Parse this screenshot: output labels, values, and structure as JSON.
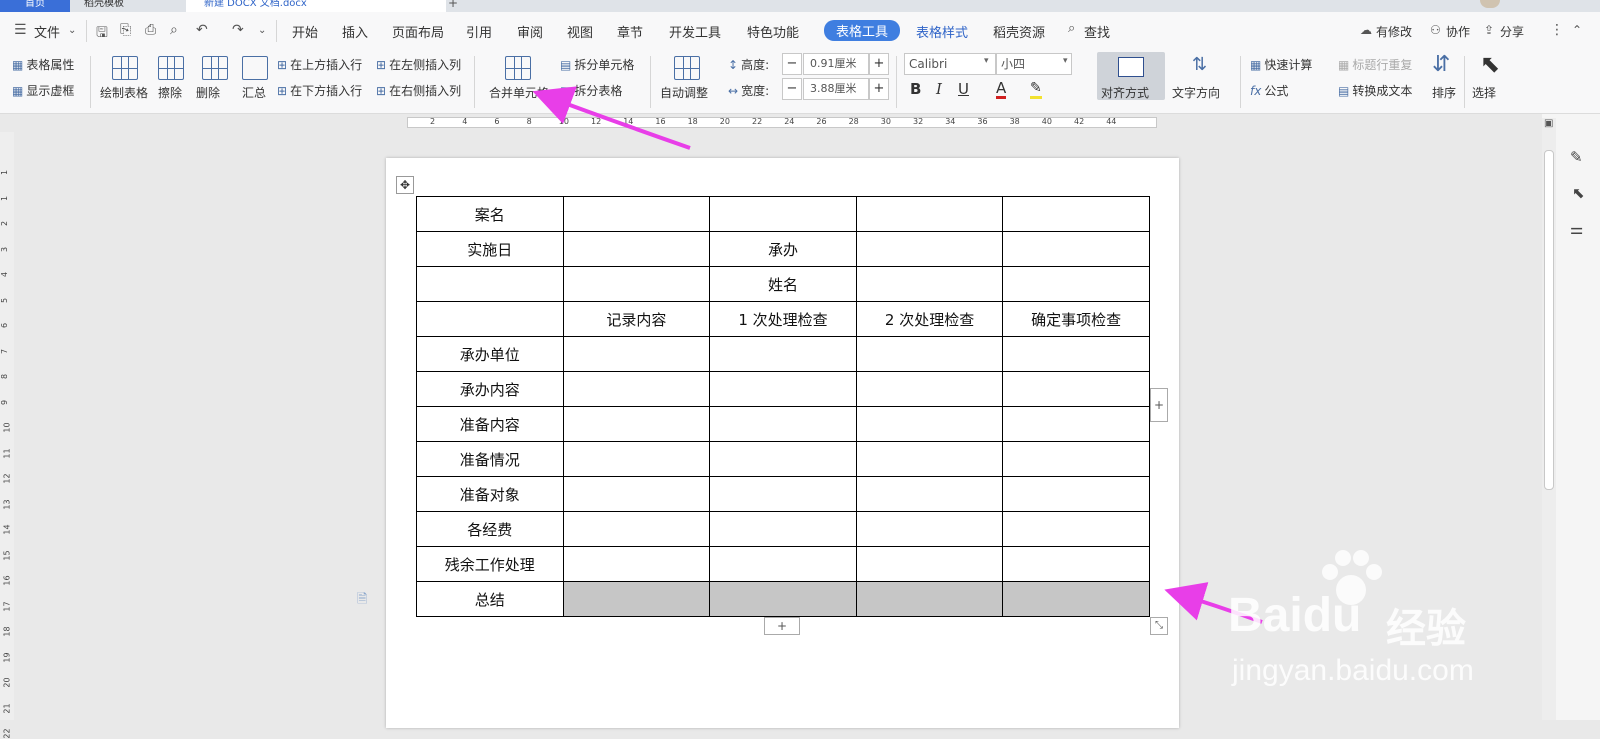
{
  "tabs": {
    "home": "首页",
    "template": "稻壳模板",
    "document": "新建 DOCX 文档.docx",
    "add": "+"
  },
  "menu": {
    "file": "文件",
    "items": [
      "开始",
      "插入",
      "页面布局",
      "引用",
      "审阅",
      "视图",
      "章节",
      "开发工具",
      "特色功能"
    ],
    "table_tools": "表格工具",
    "table_style": "表格样式",
    "docer": "稻壳资源",
    "search": "查找",
    "modify": "有修改",
    "collab": "协作",
    "share": "分享"
  },
  "ribbon": {
    "table_props": "表格属性",
    "show_gridlines": "显示虚框",
    "draw_table": "绘制表格",
    "erase": "擦除",
    "delete": "删除",
    "summary": "汇总",
    "insert_row_above": "在上方插入行",
    "insert_row_below": "在下方插入行",
    "insert_col_left": "在左侧插入列",
    "insert_col_right": "在右侧插入列",
    "merge_cells": "合并单元格",
    "split_cells": "拆分单元格",
    "split_table": "拆分表格",
    "auto_fit": "自动调整",
    "height_label": "高度:",
    "height_value": "0.91厘米",
    "width_label": "宽度:",
    "width_value": "3.88厘米",
    "font_name": "Calibri",
    "font_size": "小四",
    "bold": "B",
    "italic": "I",
    "underline": "U",
    "font_color": "A",
    "align": "对齐方式",
    "text_direction": "文字方向",
    "quick_calc": "快速计算",
    "formula": "公式",
    "repeat_header": "标题行重复",
    "to_text": "转换成文本",
    "sort": "排序",
    "select": "选择"
  },
  "ruler_h": [
    "2",
    "4",
    "6",
    "8",
    "10",
    "12",
    "14",
    "16",
    "18",
    "20",
    "22",
    "24",
    "26",
    "28",
    "30",
    "32",
    "34",
    "36",
    "38",
    "40",
    "42",
    "44"
  ],
  "ruler_v": [
    "1",
    "1",
    "2",
    "3",
    "4",
    "5",
    "6",
    "7",
    "8",
    "9",
    "10",
    "11",
    "12",
    "13",
    "14",
    "15",
    "16",
    "17",
    "18",
    "19",
    "20",
    "21",
    "22"
  ],
  "table": {
    "rows": [
      [
        "案名",
        "",
        "",
        "",
        ""
      ],
      [
        "实施日",
        "",
        "承办",
        "",
        ""
      ],
      [
        "",
        "",
        "姓名",
        "",
        ""
      ],
      [
        "",
        "记录内容",
        "1 次处理检查",
        "2 次处理检查",
        "确定事项检查"
      ],
      [
        "承办单位",
        "",
        "",
        "",
        ""
      ],
      [
        "承办内容",
        "",
        "",
        "",
        ""
      ],
      [
        "准备内容",
        "",
        "",
        "",
        ""
      ],
      [
        "准备情况",
        "",
        "",
        "",
        ""
      ],
      [
        "准备对象",
        "",
        "",
        "",
        ""
      ],
      [
        "各经费",
        "",
        "",
        "",
        ""
      ],
      [
        "残余工作处理",
        "",
        "",
        "",
        ""
      ],
      [
        "总结",
        "",
        "",
        "",
        ""
      ]
    ]
  },
  "add_row": "+",
  "add_col": "+",
  "watermark": {
    "brand": "Baidu",
    "brand_cn": "经验",
    "url": "jingyan.baidu.com"
  },
  "colors": {
    "accent": "#3f7ee0",
    "arrow": "#e83ee8",
    "selected_cell": "#c6c6c6"
  }
}
